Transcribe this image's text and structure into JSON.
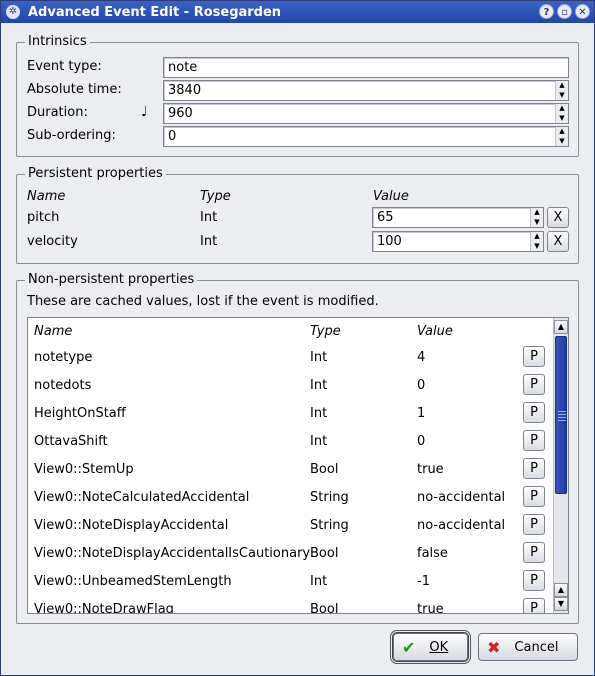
{
  "window": {
    "title": "Advanced Event Edit - Rosegarden",
    "buttons": [
      "?",
      "▫",
      "✕"
    ]
  },
  "intrinsics": {
    "title": "Intrinsics",
    "fields": [
      {
        "label": "Event type:",
        "value": "note",
        "spin": false
      },
      {
        "label": "Absolute time:",
        "value": "3840",
        "spin": true
      },
      {
        "label": "Duration:",
        "value": "960",
        "spin": true,
        "icon": "♩"
      },
      {
        "label": "Sub-ordering:",
        "value": "0",
        "spin": true
      }
    ]
  },
  "persistent": {
    "title": "Persistent properties",
    "headers": {
      "name": "Name",
      "type": "Type",
      "value": "Value"
    },
    "rows": [
      {
        "name": "pitch",
        "type": "Int",
        "value": "65",
        "button": "X"
      },
      {
        "name": "velocity",
        "type": "Int",
        "value": "100",
        "button": "X"
      }
    ]
  },
  "nonpersistent": {
    "title": "Non-persistent properties",
    "note": "These are cached values, lost if the event is modified.",
    "headers": {
      "name": "Name",
      "type": "Type",
      "value": "Value"
    },
    "rows": [
      {
        "name": "notetype",
        "type": "Int",
        "value": "4",
        "button": "P"
      },
      {
        "name": "notedots",
        "type": "Int",
        "value": "0",
        "button": "P"
      },
      {
        "name": "HeightOnStaff",
        "type": "Int",
        "value": "1",
        "button": "P"
      },
      {
        "name": "OttavaShift",
        "type": "Int",
        "value": "0",
        "button": "P"
      },
      {
        "name": "View0::StemUp",
        "type": "Bool",
        "value": "true",
        "button": "P"
      },
      {
        "name": "View0::NoteCalculatedAccidental",
        "type": "String",
        "value": "no-accidental",
        "button": "P"
      },
      {
        "name": "View0::NoteDisplayAccidental",
        "type": "String",
        "value": "no-accidental",
        "button": "P"
      },
      {
        "name": "View0::NoteDisplayAccidentalIsCautionary",
        "type": "Bool",
        "value": "false",
        "button": "P"
      },
      {
        "name": "View0::UnbeamedStemLength",
        "type": "Int",
        "value": "-1",
        "button": "P"
      },
      {
        "name": "View0::NoteDrawFlag",
        "type": "Bool",
        "value": "true",
        "button": "P"
      }
    ]
  },
  "footer": {
    "ok_label": "OK",
    "cancel_label": "Cancel"
  }
}
